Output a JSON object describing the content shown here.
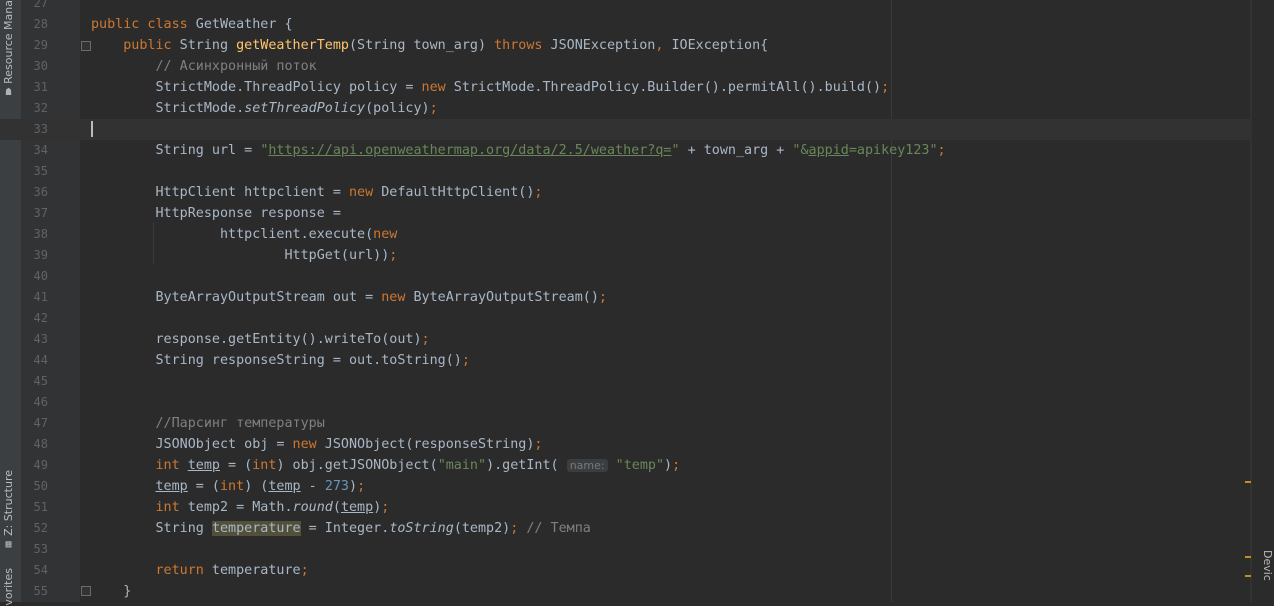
{
  "left_tabs": {
    "resource_manager": "Resource Mana",
    "structure": "Z: Structure",
    "favorites": "vorites"
  },
  "right_tabs": {
    "device": "Devic"
  },
  "editor": {
    "current_line": 33,
    "lines": [
      {
        "n": "27",
        "html": ""
      },
      {
        "n": "28",
        "html": "<span class='kw'>public class</span> GetWeather {"
      },
      {
        "n": "29",
        "html": "    <span class='kw'>public</span> String <span class='fn'>getWeatherTemp</span>(String town_arg) <span class='kw'>throws</span> JSONException<span class='semi'>,</span> IOException{"
      },
      {
        "n": "30",
        "html": "        <span class='cmt'>// Асинхронный поток</span>"
      },
      {
        "n": "31",
        "html": "        StrictMode.ThreadPolicy policy = <span class='kw'>new</span> StrictMode.ThreadPolicy.Builder().permitAll().build()<span class='semi'>;</span>"
      },
      {
        "n": "32",
        "html": "        StrictMode.<span class='it'>setThreadPolicy</span>(policy)<span class='semi'>;</span>"
      },
      {
        "n": "33",
        "html": ""
      },
      {
        "n": "34",
        "html": "        String url = <span class='str'>\"<span class='ul'>https://api.openweathermap.org/data/2.5/weather?q=</span>\"</span> + town_arg + <span class='str'>\"&amp;<span class='ul'>appid</span>=apikey123\"</span><span class='semi'>;</span>"
      },
      {
        "n": "35",
        "html": ""
      },
      {
        "n": "36",
        "html": "        HttpClient httpclient = <span class='kw'>new</span> DefaultHttpClient()<span class='semi'>;</span>"
      },
      {
        "n": "37",
        "html": "        HttpResponse response ="
      },
      {
        "n": "38",
        "html": "                httpclient.execute(<span class='kw'>new</span>"
      },
      {
        "n": "39",
        "html": "                        HttpGet(url))<span class='semi'>;</span>"
      },
      {
        "n": "40",
        "html": ""
      },
      {
        "n": "41",
        "html": "        ByteArrayOutputStream out = <span class='kw'>new</span> ByteArrayOutputStream()<span class='semi'>;</span>"
      },
      {
        "n": "42",
        "html": ""
      },
      {
        "n": "43",
        "html": "        response.getEntity().writeTo(out)<span class='semi'>;</span>"
      },
      {
        "n": "44",
        "html": "        String responseString = out.toString()<span class='semi'>;</span>"
      },
      {
        "n": "45",
        "html": ""
      },
      {
        "n": "46",
        "html": ""
      },
      {
        "n": "47",
        "html": "        <span class='cmt'>//Парсинг температуры</span>"
      },
      {
        "n": "48",
        "html": "        JSONObject obj = <span class='kw'>new</span> JSONObject(responseString)<span class='semi'>;</span>"
      },
      {
        "n": "49",
        "html": "        <span class='kw'>int</span> <span class='ul'>temp</span> = (<span class='kw'>int</span>) obj.getJSONObject(<span class='str'>\"main\"</span>).getInt( <span class='hint'>name:</span> <span class='str'>\"temp\"</span>)<span class='semi'>;</span>"
      },
      {
        "n": "50",
        "html": "        <span class='ul'>temp</span> = (<span class='kw'>int</span>) (<span class='ul'>temp</span> - <span class='num'>273</span>)<span class='semi'>;</span>"
      },
      {
        "n": "51",
        "html": "        <span class='kw'>int</span> temp2 = Math.<span class='it'>round</span>(<span class='ul'>temp</span>)<span class='semi'>;</span>"
      },
      {
        "n": "52",
        "html": "        String <span class='hl'>temperature</span> = Integer.<span class='it'>toString</span>(temp2)<span class='semi'>;</span> <span class='cmt'>// Темпа</span>"
      },
      {
        "n": "53",
        "html": ""
      },
      {
        "n": "54",
        "html": "        <span class='kw'>return</span> temperature<span class='semi'>;</span>"
      },
      {
        "n": "55",
        "html": "    }"
      }
    ]
  }
}
